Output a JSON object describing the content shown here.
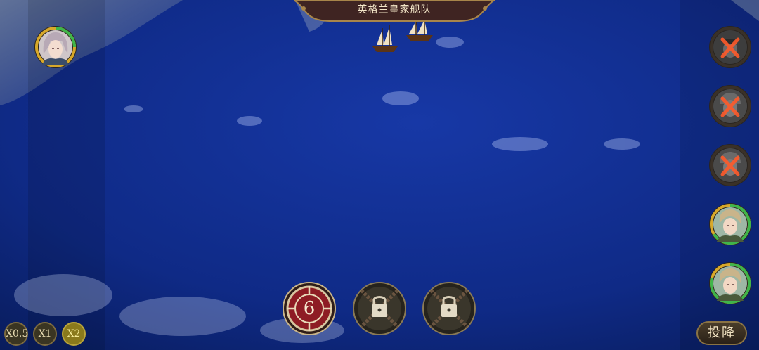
{
  "fleet_banner": {
    "title": "英格兰皇家舰队"
  },
  "speed_controls": [
    {
      "label": "X0.5",
      "active": false
    },
    {
      "label": "X1",
      "active": false
    },
    {
      "label": "X2",
      "active": true
    }
  ],
  "surrender_button": {
    "label": "投降"
  },
  "skills": [
    {
      "icon": "crosshair-target-icon",
      "count": "6",
      "locked": false
    },
    {
      "icon": "lock-icon",
      "locked": true
    },
    {
      "icon": "lock-icon",
      "locked": true
    }
  ],
  "player_fleet": [
    {
      "icon": "female-captain-portrait",
      "status": "active"
    }
  ],
  "enemy_fleet": [
    {
      "icon": "captain-portrait",
      "status": "defeated"
    },
    {
      "icon": "captain-portrait",
      "status": "defeated"
    },
    {
      "icon": "captain-portrait",
      "status": "defeated"
    },
    {
      "icon": "captain-portrait",
      "status": "active"
    },
    {
      "icon": "captain-portrait",
      "status": "active"
    }
  ],
  "colors": {
    "sea": "#0e2a8a",
    "ring_gold": "#d7a82a",
    "ring_green": "#3fb54a",
    "defeat_mark": "#ff5a2a",
    "skill_red": "#8e1c24"
  }
}
